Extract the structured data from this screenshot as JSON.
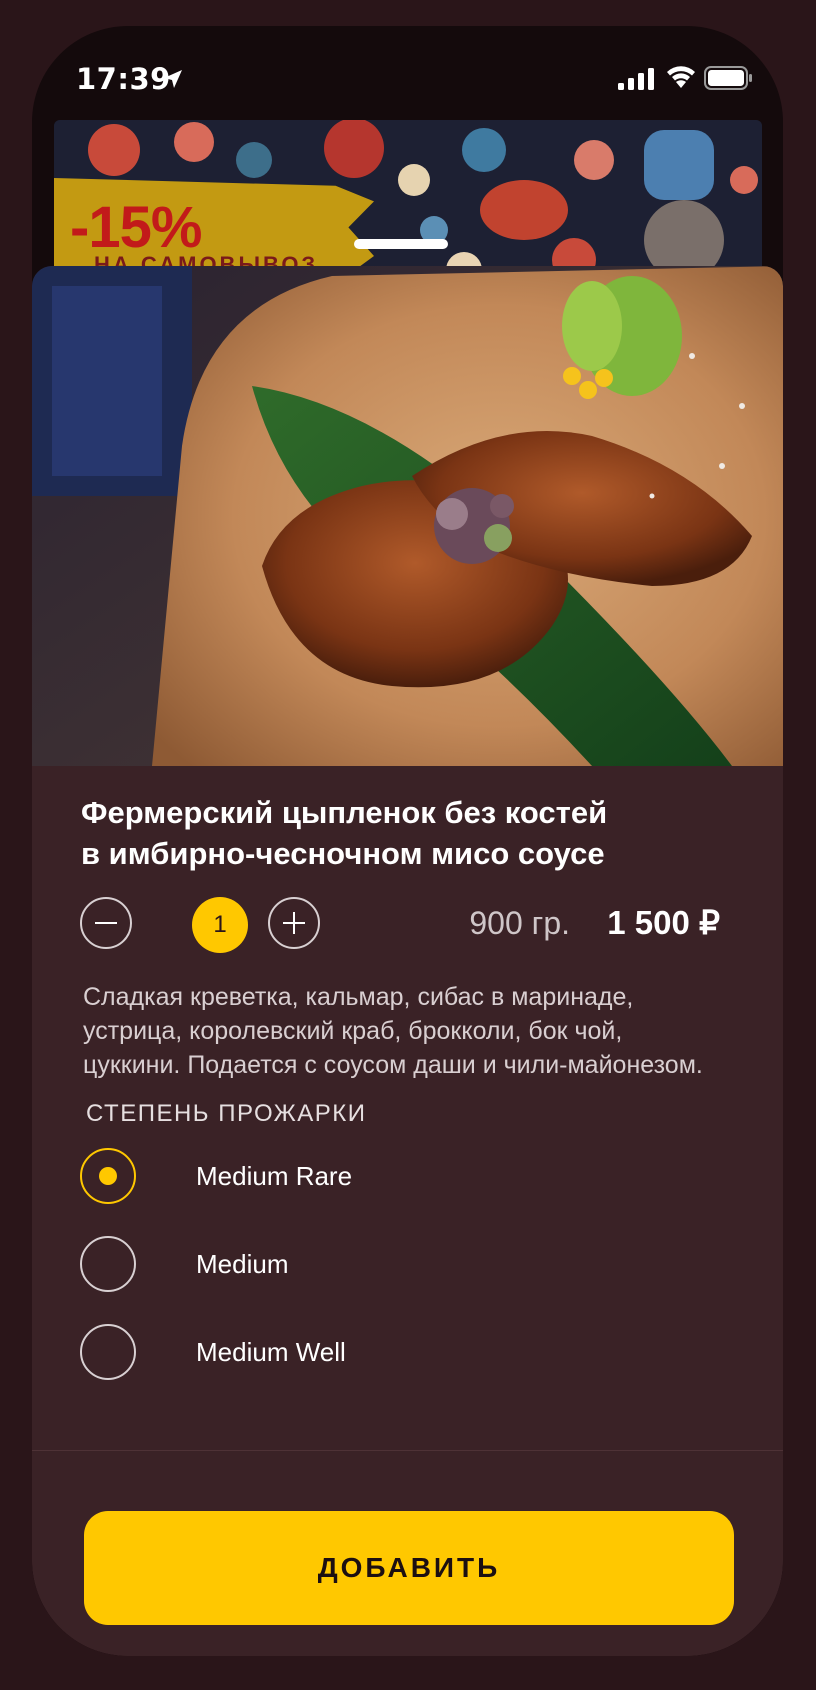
{
  "status_bar": {
    "time": "17:39"
  },
  "banner": {
    "discount": "-15%",
    "subtitle": "на самовывоз"
  },
  "dish": {
    "title_line1": "Фермерский цыпленок без костей",
    "title_line2": "в имбирно-чесночном мисо соусе",
    "quantity": "1",
    "weight": "900 гр.",
    "price": "1 500 ₽",
    "description": "Сладкая креветка, кальмар, сибас в маринаде, устрица, королевский краб, брокколи, бок чой, цуккини. Подается с соусом даши и чили-майонезом."
  },
  "doneness": {
    "label": "СТЕПЕНЬ ПРОЖАРКИ",
    "options": [
      {
        "label": "Medium Rare",
        "selected": true
      },
      {
        "label": "Medium",
        "selected": false
      },
      {
        "label": "Medium Well",
        "selected": false
      }
    ]
  },
  "footer": {
    "add_label": "ДОБАВИТЬ"
  },
  "colors": {
    "accent": "#ffc800",
    "sheet_bg": "#3a2226",
    "page_bg": "#2a1519"
  },
  "icons": [
    "location-arrow-icon",
    "signal-icon",
    "wifi-icon",
    "battery-icon",
    "minus-icon",
    "plus-icon"
  ]
}
